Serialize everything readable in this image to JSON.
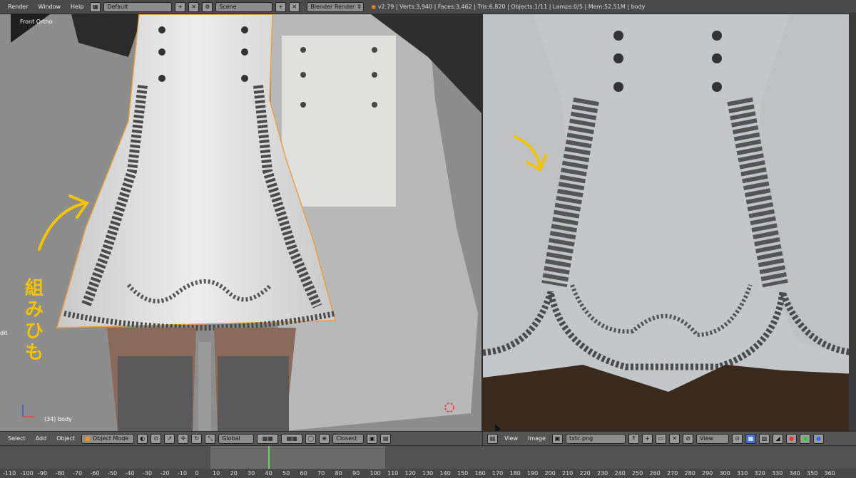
{
  "topbar": {
    "menus": [
      "Render",
      "Window",
      "Help"
    ],
    "screen_layout": "Default",
    "scene": "Scene",
    "engine": "Blender Render",
    "stats": "v2.79 | Verts:3,940 | Faces:3,462 | Tris:6,820 | Objects:1/11 | Lamps:0/5 | Mem:52.51M | body"
  },
  "viewport3d": {
    "view_label": "Front Ortho",
    "object_label": "(34) body",
    "side_text": "dit",
    "annotation": "組みひも",
    "header": {
      "menus": [
        "Select",
        "Add",
        "Object"
      ],
      "mode": "Object Mode",
      "orientation": "Global",
      "snap": "Closest"
    }
  },
  "image_editor": {
    "header": {
      "menus": [
        "View",
        "Image"
      ],
      "image_name": "txtc.png",
      "fake_user": "F",
      "view_mode": "View"
    }
  },
  "timeline": {
    "current_frame": 34,
    "ticks": [
      -110,
      -100,
      -90,
      -80,
      -70,
      -60,
      -50,
      -40,
      -30,
      -20,
      -10,
      0,
      10,
      20,
      30,
      40,
      50,
      60,
      70,
      80,
      90,
      100,
      110,
      120,
      130,
      140,
      150,
      160,
      170,
      180,
      190,
      200,
      210,
      220,
      230,
      240,
      250,
      260,
      270,
      280,
      290,
      300,
      310,
      320,
      330,
      340,
      350,
      360
    ]
  },
  "colors": {
    "annotation": "#f2c300",
    "selection_outline": "#e8a040",
    "current_frame": "#5fd85f"
  }
}
